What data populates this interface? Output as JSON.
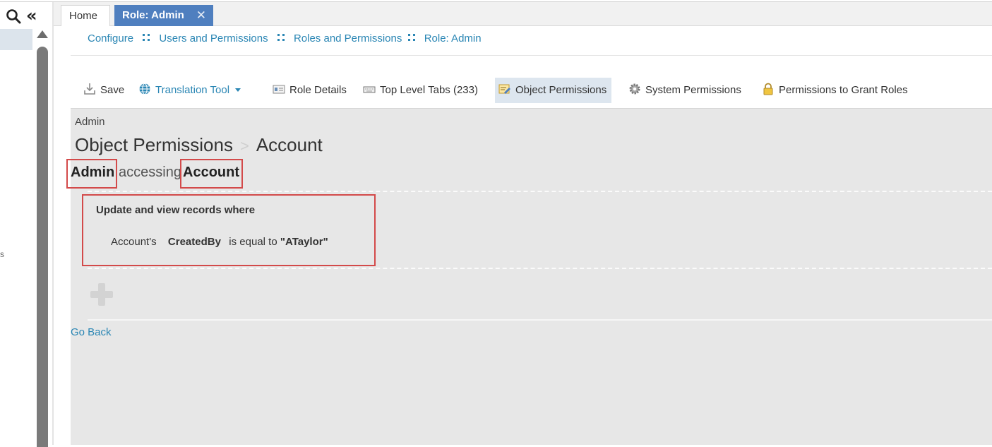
{
  "left_rail": {
    "collapse_glyph": "«",
    "partial_label": "s"
  },
  "tabs": [
    {
      "label": "Home",
      "active": false
    },
    {
      "label": "Role: Admin",
      "active": true,
      "close": "✕"
    }
  ],
  "breadcrumb": [
    "Configure",
    "Users and Permissions",
    "Roles and Permissions",
    "Role: Admin"
  ],
  "toolbar": {
    "save": "Save",
    "translation_tool": "Translation Tool",
    "role_details": "Role Details",
    "top_level_tabs": "Top Level Tabs (233)",
    "object_permissions": "Object Permissions",
    "system_permissions": "System Permissions",
    "permissions_to_grant_roles": "Permissions to Grant Roles"
  },
  "main": {
    "role_name": "Admin",
    "heading": "Object Permissions",
    "heading_sep": ">",
    "heading_object": "Account",
    "access": {
      "role": "Admin",
      "verb": "accessing",
      "object": "Account"
    },
    "rule": {
      "title": "Update and view records where",
      "subject": "Account's",
      "field": "CreatedBy",
      "operator": "is equal to",
      "value": "\"ATaylor\""
    },
    "go_back": "Go Back"
  },
  "colors": {
    "active_tab": "#4f7fbf",
    "link": "#2a86b4",
    "highlight_box": "#d34a4a",
    "panel_bg": "#e7e7e7"
  }
}
